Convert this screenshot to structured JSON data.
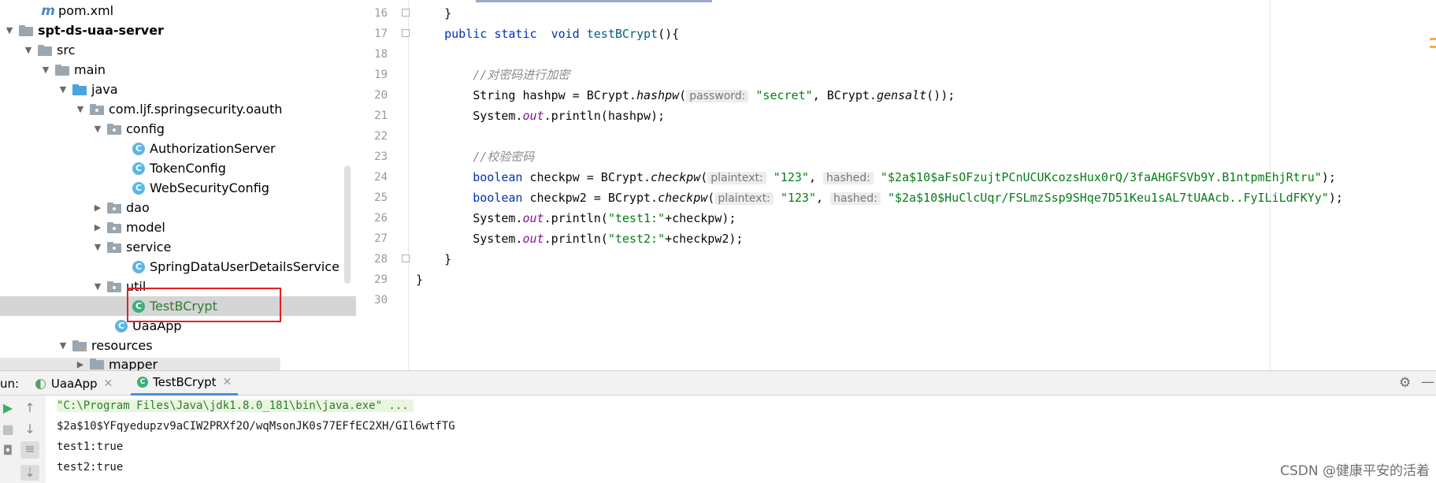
{
  "project_tree": {
    "items": [
      {
        "label": "pom.xml",
        "icon": "maven-icon",
        "arrow": ""
      },
      {
        "label": "spt-ds-uaa-server",
        "icon": "module-folder-icon",
        "arrow": "▼"
      },
      {
        "label": "src",
        "icon": "folder-icon",
        "arrow": "▼"
      },
      {
        "label": "main",
        "icon": "folder-icon",
        "arrow": "▼"
      },
      {
        "label": "java",
        "icon": "source-folder-icon",
        "arrow": "▼"
      },
      {
        "label": "com.ljf.springsecurity.oauth",
        "icon": "package-icon",
        "arrow": "▼"
      },
      {
        "label": "config",
        "icon": "package-icon",
        "arrow": "▼"
      },
      {
        "label": "AuthorizationServer",
        "icon": "class-icon",
        "arrow": ""
      },
      {
        "label": "TokenConfig",
        "icon": "class-icon",
        "arrow": ""
      },
      {
        "label": "WebSecurityConfig",
        "icon": "class-icon",
        "arrow": ""
      },
      {
        "label": "dao",
        "icon": "package-icon",
        "arrow": "▶"
      },
      {
        "label": "model",
        "icon": "package-icon",
        "arrow": "▶"
      },
      {
        "label": "service",
        "icon": "package-icon",
        "arrow": "▼"
      },
      {
        "label": "SpringDataUserDetailsService",
        "icon": "class-icon",
        "arrow": ""
      },
      {
        "label": "util",
        "icon": "package-icon",
        "arrow": "▼"
      },
      {
        "label": "TestBCrypt",
        "icon": "runnable-class-icon",
        "arrow": ""
      },
      {
        "label": "UaaApp",
        "icon": "runnable-class-icon",
        "arrow": ""
      },
      {
        "label": "resources",
        "icon": "resources-folder-icon",
        "arrow": "▼"
      },
      {
        "label": "mapper",
        "icon": "folder-icon",
        "arrow": "▶"
      }
    ],
    "selected_item": "TestBCrypt"
  },
  "editor": {
    "line_numbers": [
      "16",
      "17",
      "18",
      "19",
      "20",
      "21",
      "22",
      "23",
      "24",
      "25",
      "26",
      "27",
      "28",
      "29",
      "30"
    ],
    "lines": {
      "l16": "    }",
      "l17": {
        "kw1": "public",
        "kw2": "static",
        "kw3": "void",
        "method": "testBCrypt",
        "rest": "(){"
      },
      "l19": "//对密码进行加密",
      "l20": {
        "type": "String",
        "var": "hashpw",
        "eq": " = BCrypt.",
        "call": "hashpw",
        "open": "(",
        "hint": "password:",
        "arg": "\"secret\"",
        "mid": ", BCrypt.",
        "call2": "gensalt",
        "end": "());"
      },
      "l21": {
        "pre": "System.",
        "fld": "out",
        "post": ".println(hashpw);"
      },
      "l23": "//校验密码",
      "l24": {
        "kw": "boolean",
        "var": "checkpw",
        "eq": " = BCrypt.",
        "call": "checkpw",
        "open": "(",
        "hint1": "plaintext:",
        "arg1": "\"123\"",
        "comma": ", ",
        "hint2": "hashed:",
        "arg2": "\"$2a$10$aFsOFzujtPCnUCUKcozsHux0rQ/3faAHGFSVb9Y.B1ntpmEhjRtru\"",
        "end": ");"
      },
      "l25": {
        "kw": "boolean",
        "var": "checkpw2",
        "eq": " = BCrypt.",
        "call": "checkpw",
        "open": "(",
        "hint1": "plaintext:",
        "arg1": "\"123\"",
        "comma": ", ",
        "hint2": "hashed:",
        "arg2": "\"$2a$10$HuClcUqr/FSLmzSsp9SHqe7D51Keu1sAL7tUAAcb..FyILiLdFKYy\"",
        "end": ");"
      },
      "l26": {
        "pre": "System.",
        "fld": "out",
        "mid": ".println(",
        "str": "\"test1:\"",
        "post": "+checkpw);"
      },
      "l27": {
        "pre": "System.",
        "fld": "out",
        "mid": ".println(",
        "str": "\"test2:\"",
        "post": "+checkpw2);"
      },
      "l28": "    }",
      "l29": "}"
    }
  },
  "run_panel": {
    "label": "un:",
    "tabs": [
      {
        "label": "UaaApp",
        "close": "✕"
      },
      {
        "label": "TestBCrypt",
        "close": "✕"
      }
    ],
    "console": [
      "\"C:\\Program Files\\Java\\jdk1.8.0_181\\bin\\java.exe\" ...",
      "$2a$10$YFqyedupzv9aCIW2PRXf2O/wqMsonJK0s77EFfEC2XH/GIl6wtfTG",
      "test1:true",
      "test2:true"
    ],
    "settings_icon": "gear-icon",
    "minimize_icon": "minimize-icon"
  },
  "watermark": "CSDN @健康平安的活着",
  "colors": {
    "keyword": "#0033b3",
    "string": "#067d17",
    "comment": "#8c8c8c",
    "selection": "#d5d5d5",
    "highlight_box": "#e32020"
  }
}
